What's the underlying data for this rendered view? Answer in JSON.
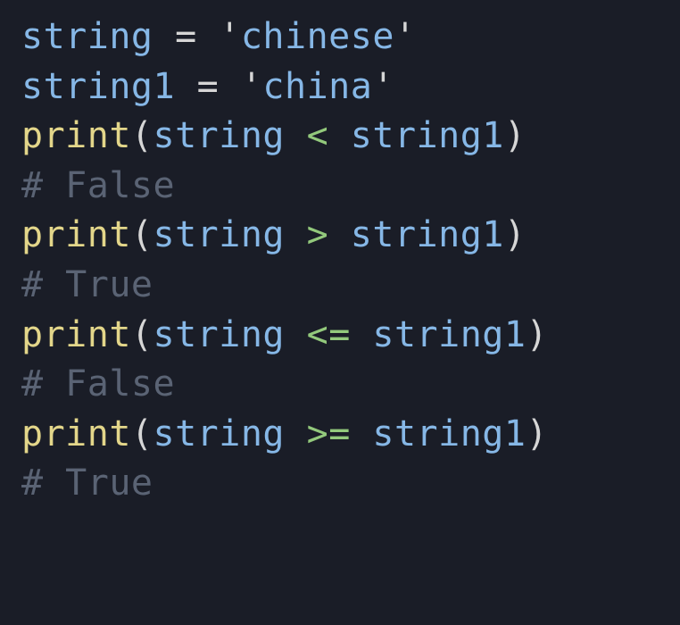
{
  "code": {
    "lines": [
      {
        "type": "assign",
        "var": "string",
        "eq": " = ",
        "q1": "'",
        "val": "chinese",
        "q2": "'"
      },
      {
        "type": "assign",
        "var": "string1",
        "eq": " = ",
        "q1": "'",
        "val": "china",
        "q2": "'"
      },
      {
        "type": "call",
        "func": "print",
        "lp": "(",
        "arg1": "string",
        "sp1": " ",
        "op": "<",
        "sp2": " ",
        "arg2": "string1",
        "rp": ")"
      },
      {
        "type": "comment",
        "text": "# False"
      },
      {
        "type": "call",
        "func": "print",
        "lp": "(",
        "arg1": "string",
        "sp1": " ",
        "op": ">",
        "sp2": " ",
        "arg2": "string1",
        "rp": ")"
      },
      {
        "type": "comment",
        "text": "# True"
      },
      {
        "type": "call",
        "func": "print",
        "lp": "(",
        "arg1": "string",
        "sp1": " ",
        "op": "<=",
        "sp2": " ",
        "arg2": "string1",
        "rp": ")"
      },
      {
        "type": "comment",
        "text": "# False"
      },
      {
        "type": "call",
        "func": "print",
        "lp": "(",
        "arg1": "string",
        "sp1": " ",
        "op": ">=",
        "sp2": " ",
        "arg2": "string1",
        "rp": ")"
      },
      {
        "type": "comment",
        "text": "# True"
      }
    ]
  }
}
